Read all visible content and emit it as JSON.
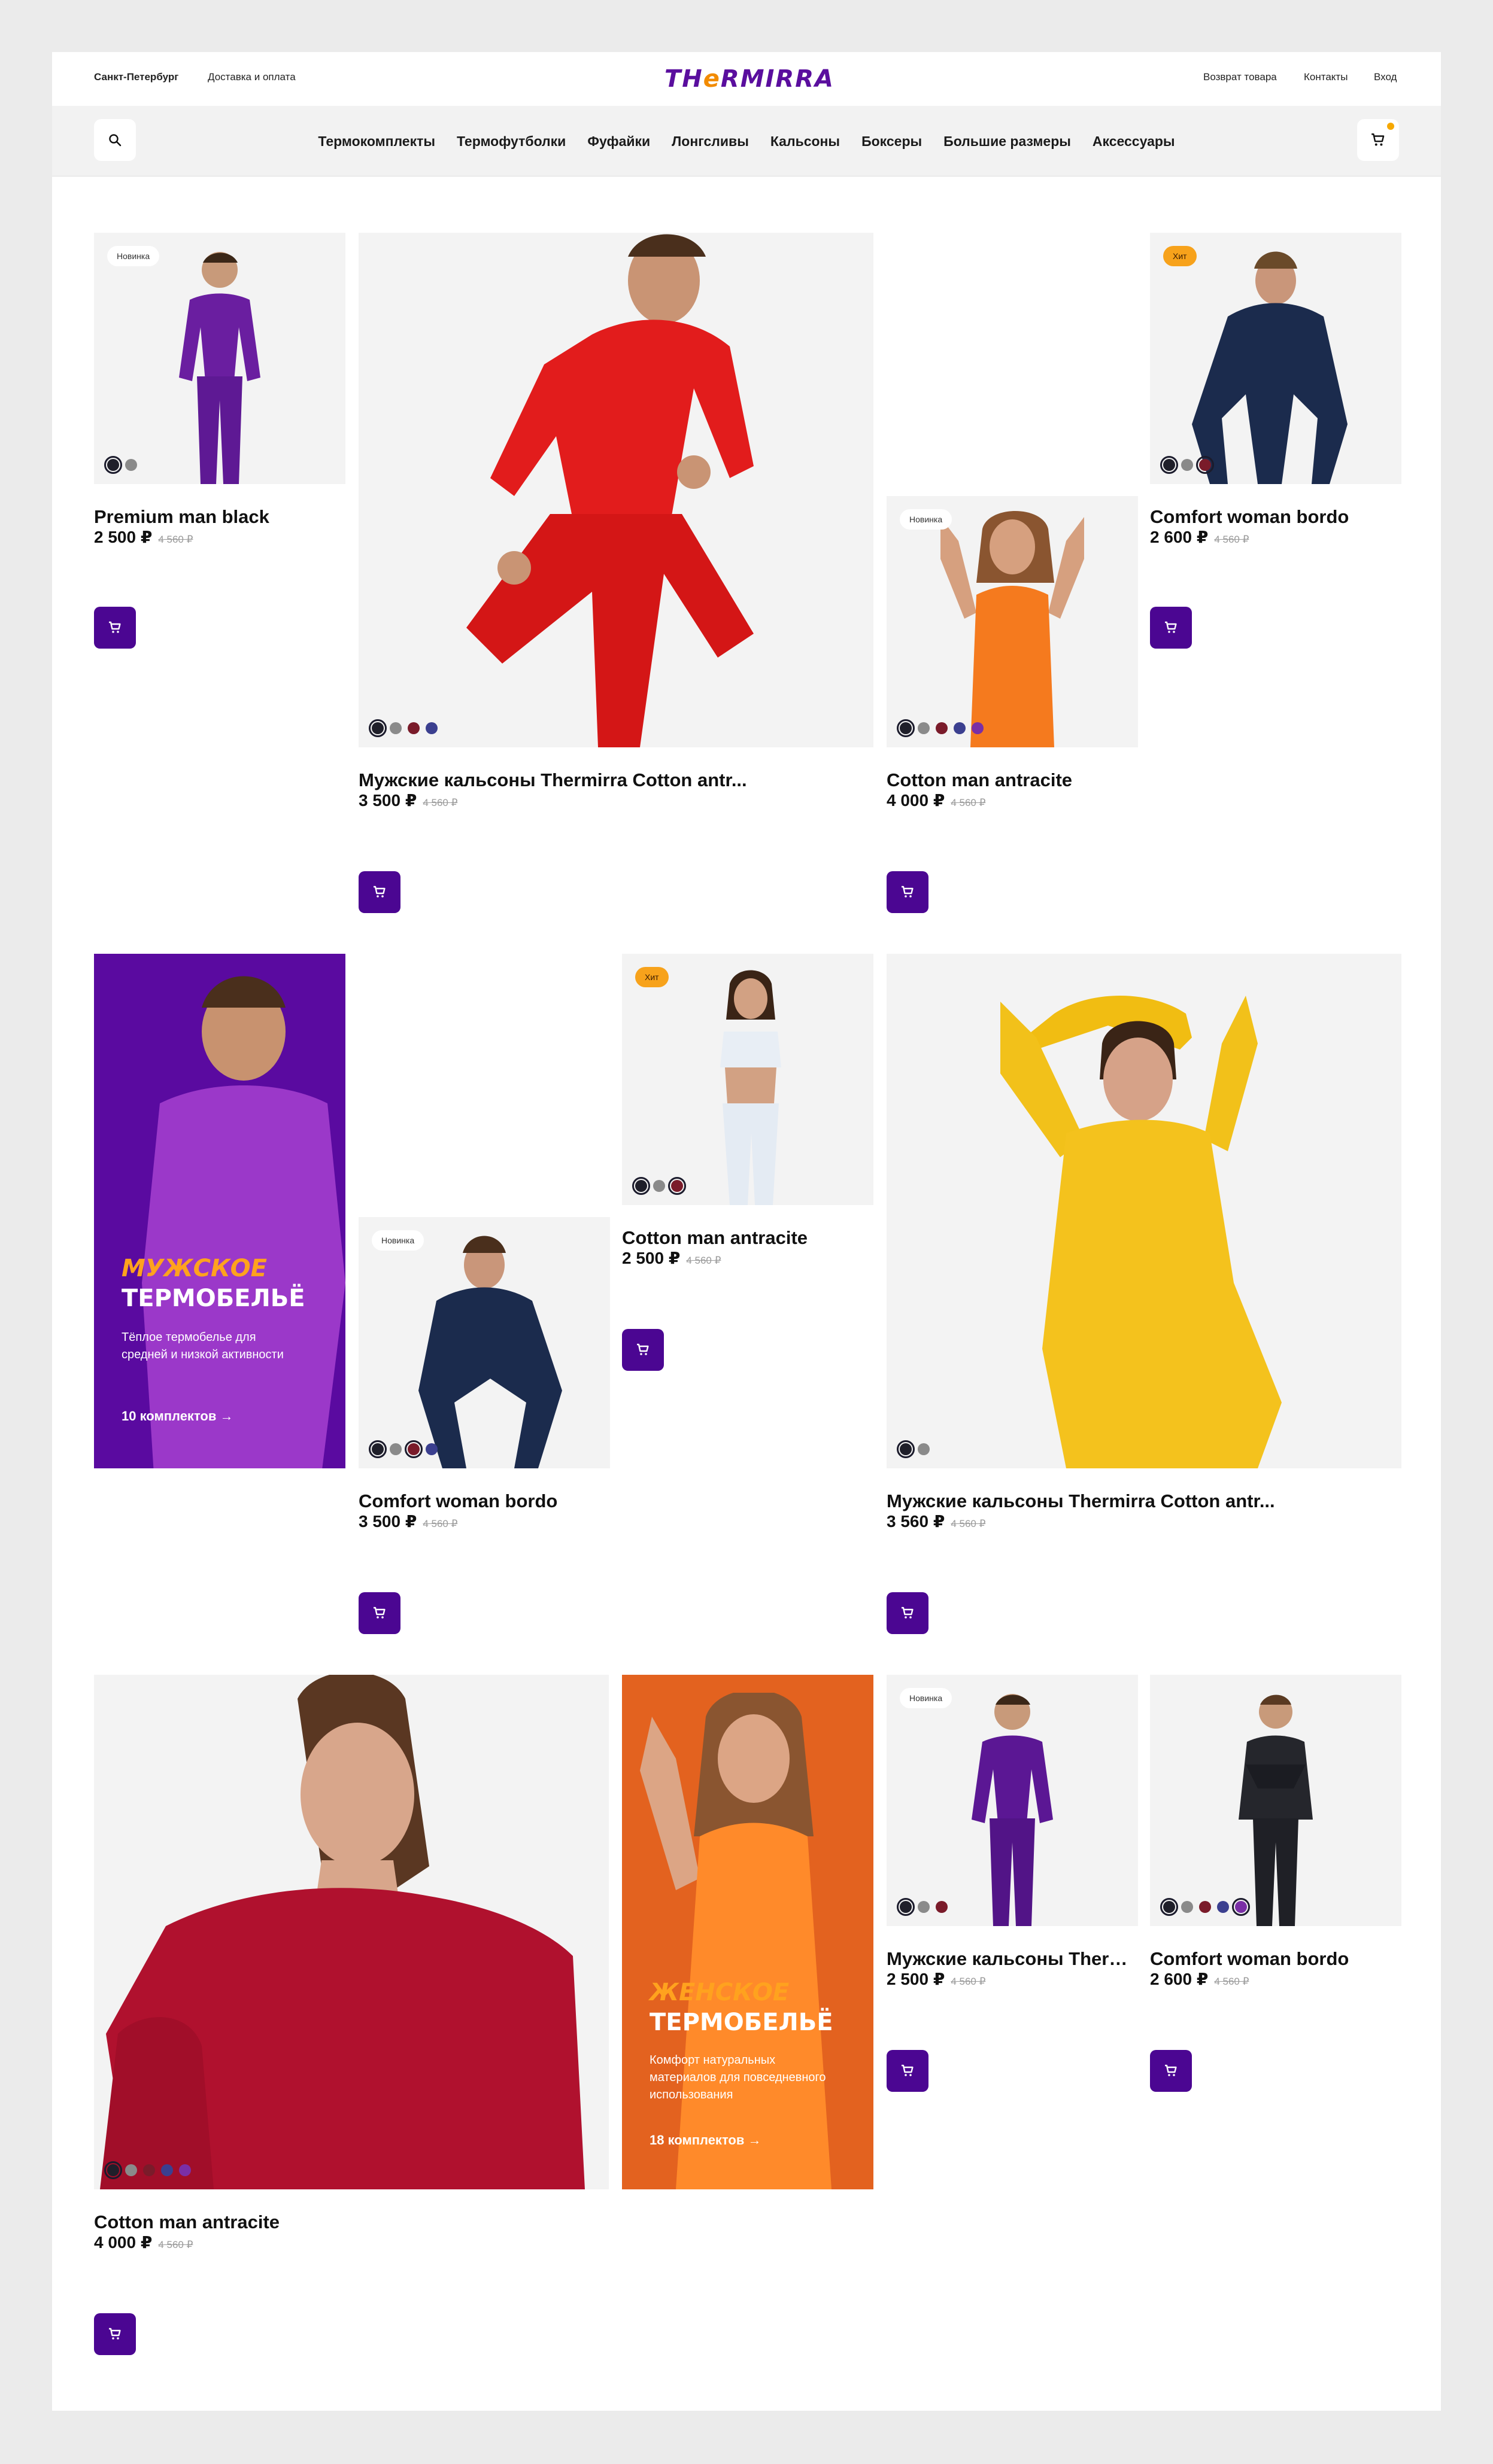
{
  "header": {
    "city": "Санкт-Петербург",
    "delivery": "Доставка и оплата",
    "logo_a": "TH",
    "logo_b": "e",
    "logo_c": "RMIRRA",
    "returns": "Возврат товара",
    "contacts": "Контакты",
    "login": "Вход"
  },
  "nav": [
    "Термокомплекты",
    "Термофутболки",
    "Фуфайки",
    "Лонгсливы",
    "Кальсоны",
    "Боксеры",
    "Большие размеры",
    "Аксессуары"
  ],
  "colors": {
    "accent": "#4b0692",
    "hit": "#f7a21b",
    "promo_men": "#5a0aa0",
    "promo_women": "#e3621f"
  },
  "products": [
    {
      "name": "Premium man black",
      "price": "2 500 ₽",
      "old": "4 560 ₽",
      "badge": "Новинка"
    },
    {
      "name": "Мужские кальсоны Thermirra Cotton antr...",
      "price": "3 500 ₽",
      "old": "4 560 ₽"
    },
    {
      "name": "Cotton man antracite",
      "price": "4 000 ₽",
      "old": "4 560 ₽",
      "badge": "Новинка"
    },
    {
      "name": "Comfort woman bordo",
      "price": "2 600 ₽",
      "old": "4 560 ₽",
      "badge": "Хит"
    },
    {
      "name": "Comfort woman bordo",
      "price": "3 500 ₽",
      "old": "4 560 ₽",
      "badge": "Новинка"
    },
    {
      "name": "Cotton man antracite",
      "price": "2 500 ₽",
      "old": "4 560 ₽",
      "badge": "Хит"
    },
    {
      "name": "Мужские кальсоны Thermirra Cotton antr...",
      "price": "3 560 ₽",
      "old": "4 560 ₽"
    },
    {
      "name": "Cotton man antracite",
      "price": "4 000 ₽",
      "old": "4 560 ₽"
    },
    {
      "name": "Мужские кальсоны Thermirra Cotton antr...",
      "price": "2 500 ₽",
      "old": "4 560 ₽",
      "badge": "Новинка"
    },
    {
      "name": "Comfort woman bordo",
      "price": "2 600 ₽",
      "old": "4 560 ₽"
    }
  ],
  "promos": {
    "men": {
      "line1": "МУЖСКОЕ",
      "line2": "ТЕРМОБЕЛЬЁ",
      "desc": "Тёплое термобелье для средней и низкой активности",
      "link": "10 комплектов"
    },
    "women": {
      "line1": "ЖЕНСКОЕ",
      "line2": "ТЕРМОБЕЛЬЁ",
      "desc": "Комфорт натуральных материалов для повседневного использования",
      "link": "18 комплектов"
    }
  }
}
